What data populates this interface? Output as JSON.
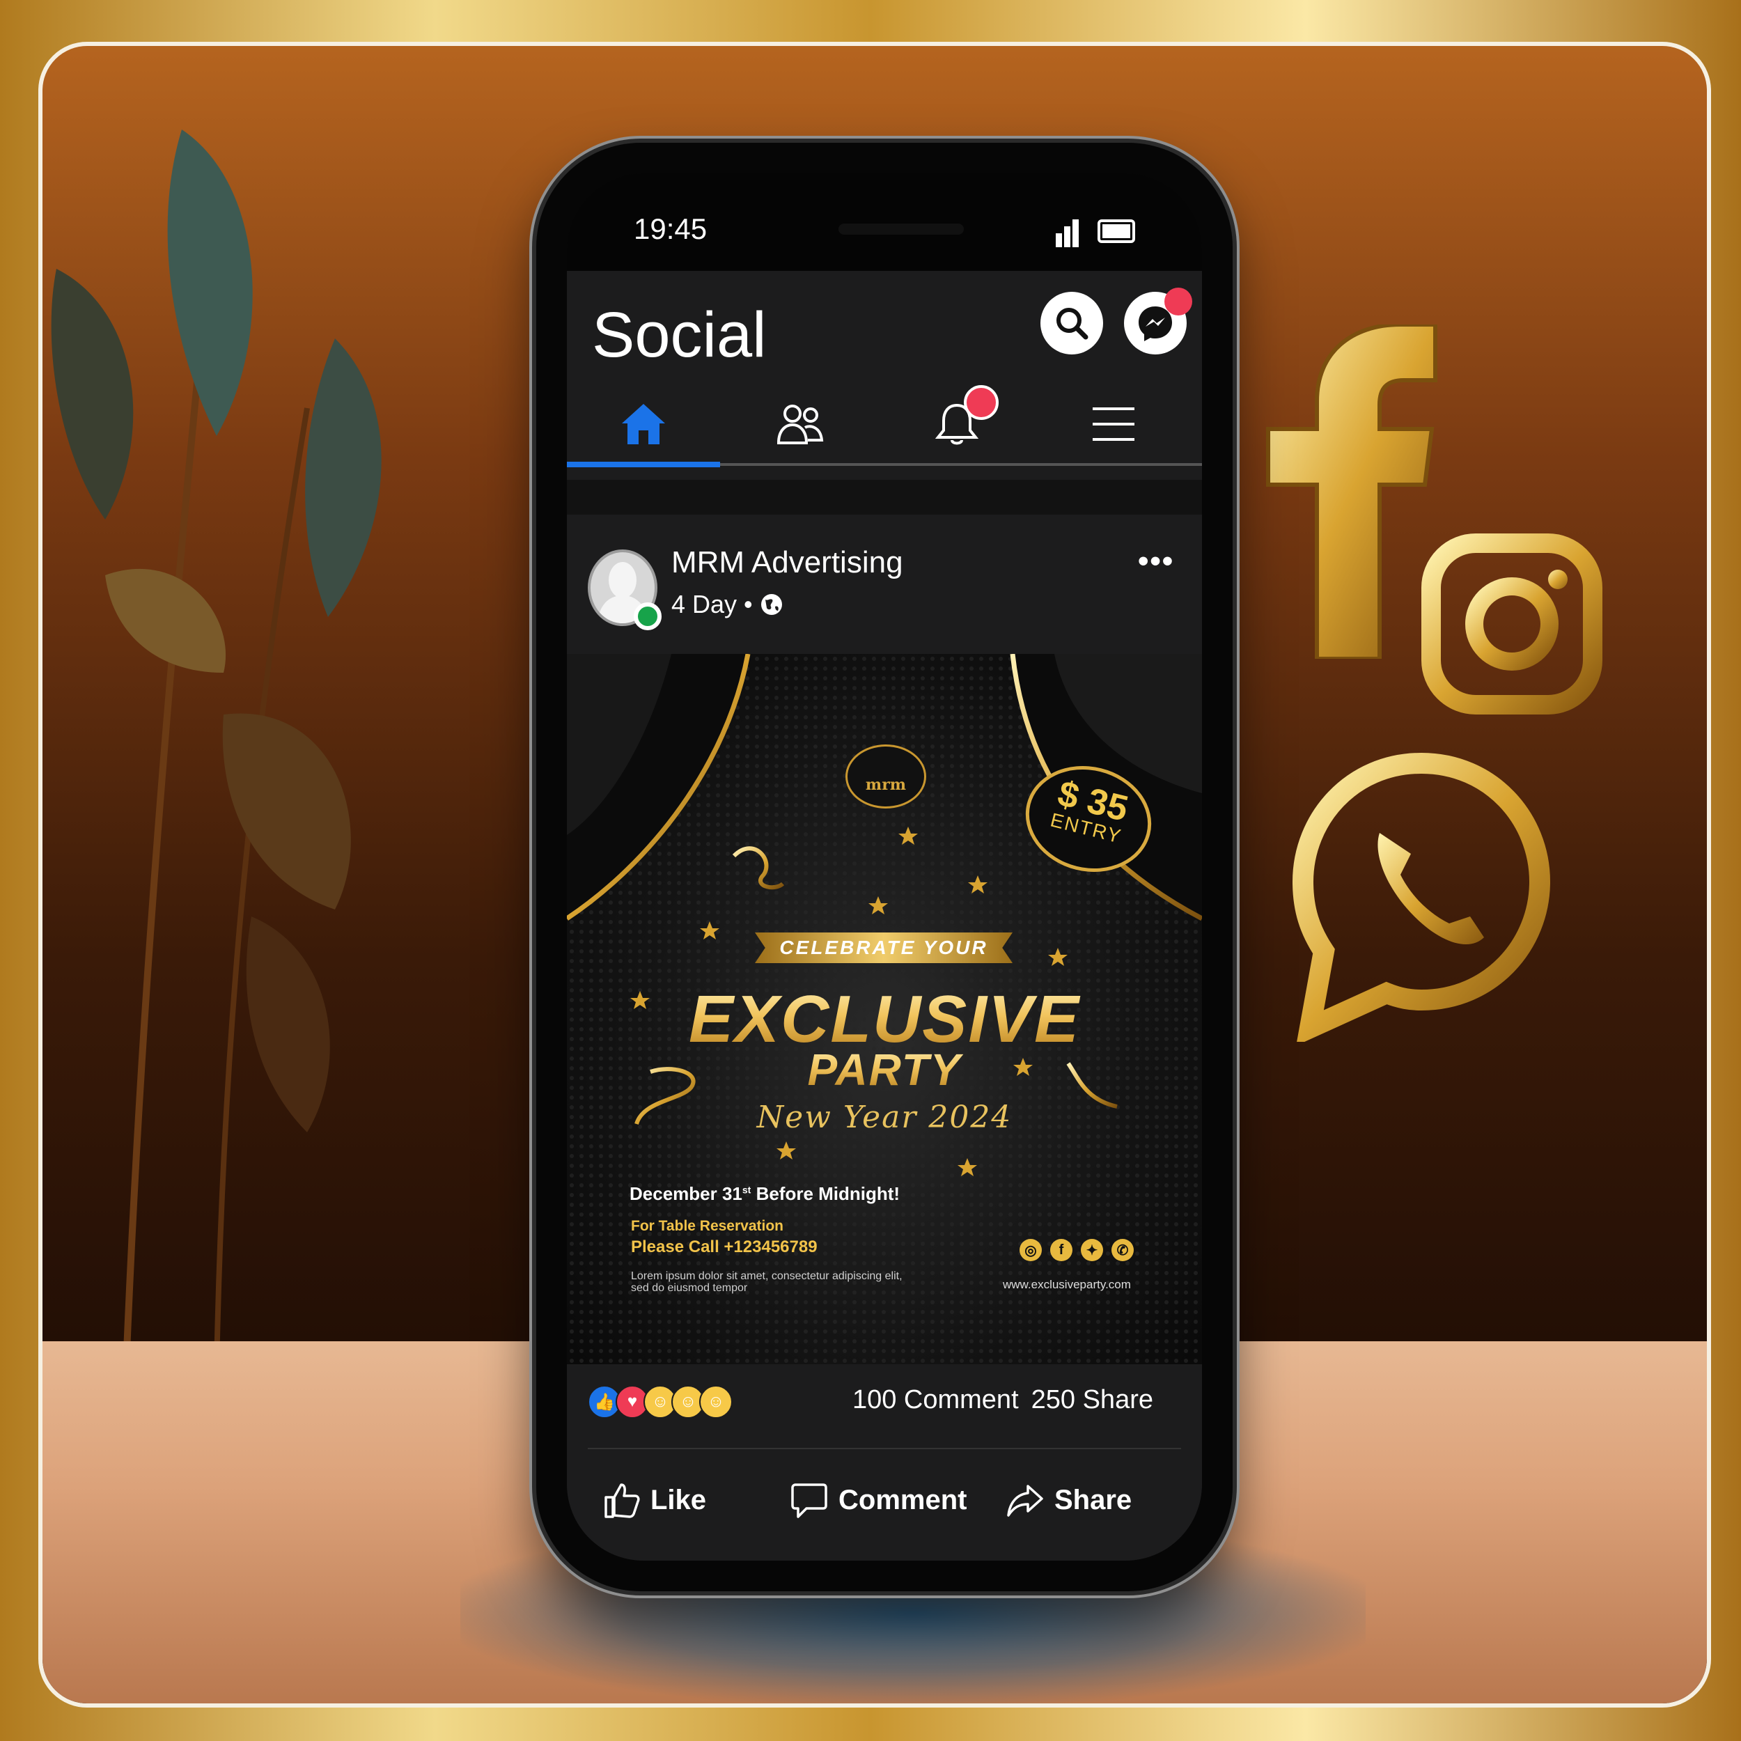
{
  "status_bar": {
    "time": "19:45"
  },
  "app": {
    "title": "Social"
  },
  "post": {
    "author": "MRM Advertising",
    "age": "4 Day •",
    "more": "•••"
  },
  "flyer": {
    "logo_text": "mrm",
    "price": "$ 35",
    "entry": "ENTRY",
    "ribbon": "CELEBRATE YOUR",
    "headline": "EXCLUSIVE",
    "subheadline": "PARTY",
    "script": "New Year 2024",
    "date_main": "December 31",
    "date_sup": "st",
    "date_rest": " Before Midnight!",
    "reservation_label": "For Table Reservation",
    "reservation_phone": "Please Call +123456789",
    "lorem": "Lorem ipsum dolor sit amet, consectetur adipiscing elit, sed do eiusmod tempor",
    "website": "www.exclusiveparty.com"
  },
  "engagement": {
    "comments": "100 Comment",
    "shares": "250 Share"
  },
  "actions": {
    "like": "Like",
    "comment": "Comment",
    "share": "Share"
  },
  "colors": {
    "accent": "#1b73e8",
    "notification": "#ef3b55",
    "gold": "#f2c94c",
    "online": "#17a34a"
  }
}
